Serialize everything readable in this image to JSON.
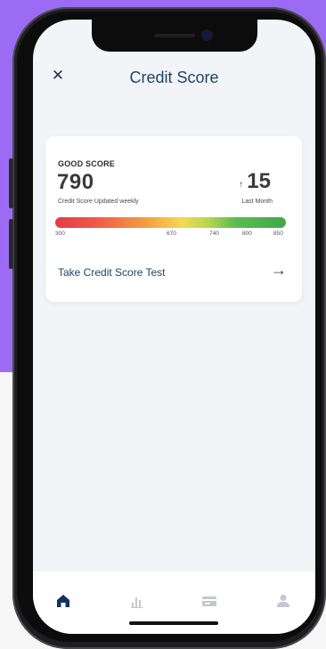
{
  "header": {
    "title": "Credit Score",
    "close_icon": "close-icon",
    "close_glyph": "✕"
  },
  "card": {
    "rating": "GOOD SCORE",
    "score": "790",
    "update_note": "Credit Score Updated weekly",
    "delta": {
      "arrow": "↑",
      "value": "15",
      "period": "Last Month"
    },
    "scale_ticks": [
      "300",
      "670",
      "740",
      "800",
      "850"
    ],
    "cta_label": "Take Credit Score Test",
    "cta_arrow": "→"
  },
  "tabbar": {
    "items": [
      {
        "name": "home",
        "icon": "home-icon",
        "active": true
      },
      {
        "name": "stats",
        "icon": "chart-icon",
        "active": false
      },
      {
        "name": "cards",
        "icon": "card-icon",
        "active": false
      },
      {
        "name": "profile",
        "icon": "user-icon",
        "active": false
      }
    ]
  },
  "colors": {
    "accent": "#1c4468",
    "background_purple": "#9b6cf3",
    "bar_red": "#e6394b",
    "bar_yellow": "#f4d853",
    "bar_green": "#3ca84b",
    "tab_inactive": "#c4c7cf"
  }
}
